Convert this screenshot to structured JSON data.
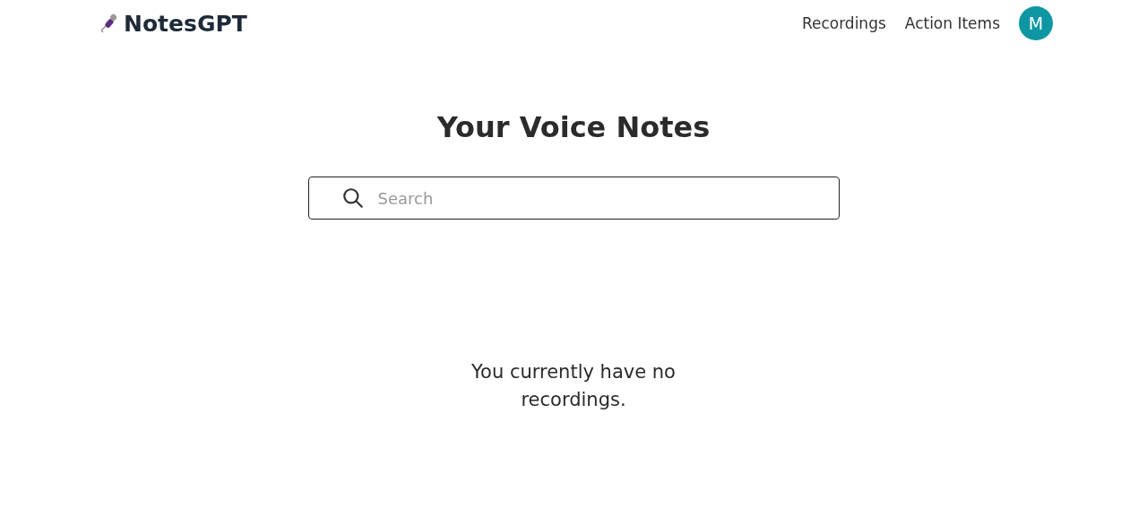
{
  "header": {
    "logo": "NotesGPT",
    "nav": [
      "Recordings",
      "Action Items"
    ],
    "avatar": "M"
  },
  "title": "Your Voice Notes",
  "search": {
    "placeholder": "Search"
  },
  "empty_message": "You currently have no recordings."
}
